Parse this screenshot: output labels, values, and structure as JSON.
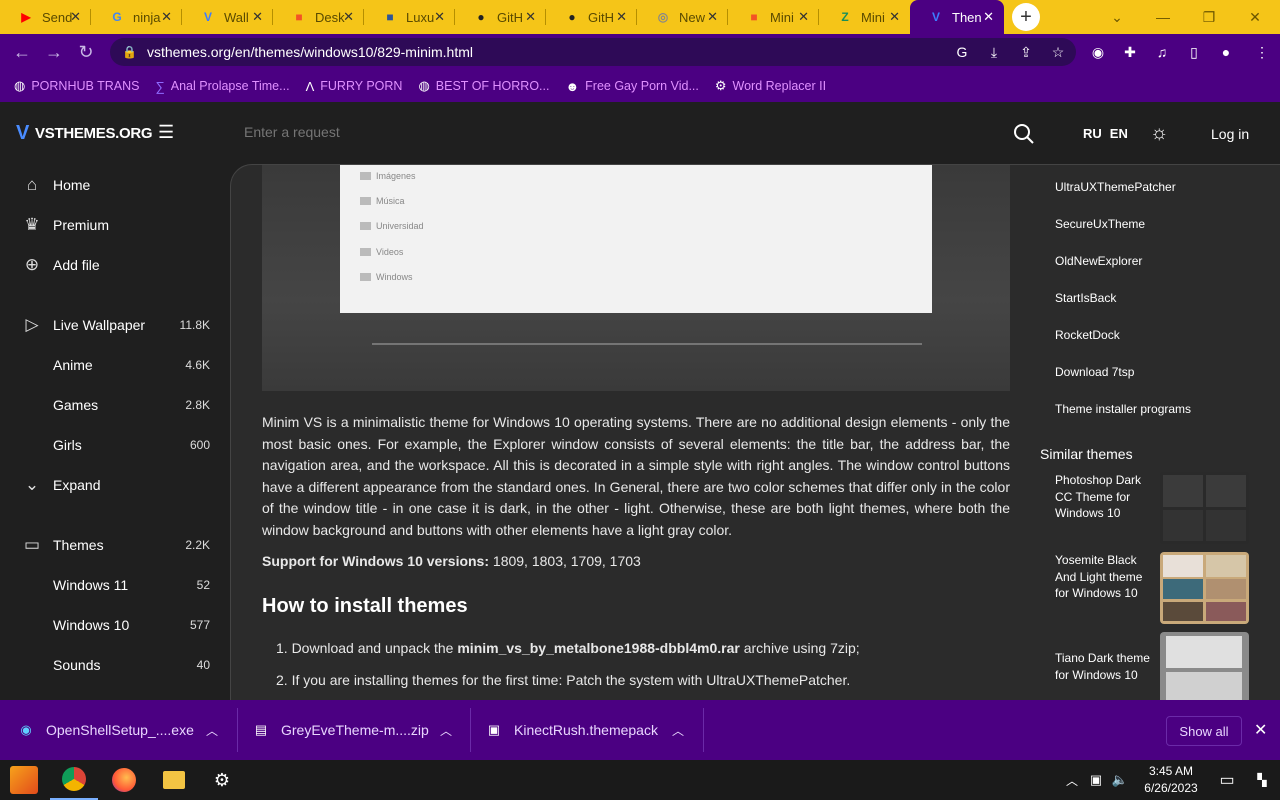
{
  "browser": {
    "tabs": [
      {
        "label": "Send",
        "icon": "youtube-icon",
        "color": "#ff0000"
      },
      {
        "label": "ninja",
        "icon": "google-icon",
        "color": "#4285f4"
      },
      {
        "label": "Wall",
        "icon": "vsthemes-icon",
        "color": "#3d7cff"
      },
      {
        "label": "Desk",
        "icon": "microsoft-icon",
        "color": "#f35325"
      },
      {
        "label": "Luxu",
        "icon": "luxury-icon",
        "color": "#2f5597"
      },
      {
        "label": "GitH",
        "icon": "github-icon",
        "color": "#222222"
      },
      {
        "label": "GitH",
        "icon": "github-icon",
        "color": "#222222"
      },
      {
        "label": "New",
        "icon": "new-tab-icon",
        "color": "#888888"
      },
      {
        "label": "Mini",
        "icon": "microsoft-icon",
        "color": "#f35325"
      },
      {
        "label": "Mini",
        "icon": "nexus-icon",
        "color": "#1a8f5a"
      },
      {
        "label": "Then",
        "icon": "vsthemes-icon",
        "color": "#3d7cff"
      }
    ],
    "url": "vsthemes.org/en/themes/windows10/829-minim.html",
    "bookmarks": [
      {
        "label": "PORNHUB TRANS",
        "icon": "globe-icon"
      },
      {
        "label": "Anal Prolapse Time...",
        "icon": "bookmark-icon"
      },
      {
        "label": "FURRY PORN",
        "icon": "furry-icon"
      },
      {
        "label": "BEST OF HORRO...",
        "icon": "globe-icon"
      },
      {
        "label": "Free Gay Porn Vid...",
        "icon": "site-icon"
      },
      {
        "label": "Word Replacer II",
        "icon": "extension-icon"
      }
    ]
  },
  "site": {
    "logo": "VSTHEMES.ORG",
    "search_placeholder": "Enter a request",
    "lang_ru": "RU",
    "lang_en": "EN",
    "login": "Log in"
  },
  "sidebar": [
    {
      "label": "Home",
      "icon": "home-icon",
      "count": ""
    },
    {
      "label": "Premium",
      "icon": "crown-icon",
      "count": ""
    },
    {
      "label": "Add file",
      "icon": "plus-circle-icon",
      "count": ""
    },
    {
      "label": "Live Wallpaper",
      "icon": "play-icon",
      "count": "11.8K"
    },
    {
      "label": "Anime",
      "icon": "",
      "count": "4.6K"
    },
    {
      "label": "Games",
      "icon": "",
      "count": "2.8K"
    },
    {
      "label": "Girls",
      "icon": "",
      "count": "600"
    },
    {
      "label": "Expand",
      "icon": "chevron-down-icon",
      "count": ""
    },
    {
      "label": "Themes",
      "icon": "monitor-icon",
      "count": "2.2K"
    },
    {
      "label": "Windows 11",
      "icon": "",
      "count": "52"
    },
    {
      "label": "Windows 10",
      "icon": "",
      "count": "577"
    },
    {
      "label": "Sounds",
      "icon": "",
      "count": "40"
    }
  ],
  "hero_folders": [
    "Imágenes",
    "Música",
    "Universidad",
    "Videos",
    "Windows"
  ],
  "article": {
    "description": "Minim VS is a minimalistic theme for Windows 10 operating systems. There are no additional design elements - only the most basic ones. For example, the Explorer window consists of several elements: the title bar, the address bar, the navigation area, and the workspace. All this is decorated in a simple style with right angles. The window control buttons have a different appearance from the standard ones. In General, there are two color schemes that differ only in the color of the window title - in one case it is dark, in the other - light. Otherwise, these are both light themes, where both the window background and buttons with other elements have a light gray color.",
    "support_label": "Support for Windows 10 versions:",
    "support_versions": "1809, 1803, 1709, 1703",
    "howto_title": "How to install themes",
    "step1_prefix": "1. Download and unpack the ",
    "step1_file": "minim_vs_by_metalbone1988-dbbl4m0.rar",
    "step1_suffix": " archive using 7zip;",
    "step2": "2. If you are installing themes for the first time: Patch the system with UltraUXThemePatcher."
  },
  "right_links": [
    "UltraUXThemePatcher",
    "SecureUxTheme",
    "OldNewExplorer",
    "StartIsBack",
    "RocketDock",
    "Download 7tsp",
    "Theme installer programs"
  ],
  "similar": {
    "title": "Similar themes",
    "items": [
      {
        "title": "Photoshop Dark CC Theme for Windows 10"
      },
      {
        "title": "Yosemite Black And Light theme for Windows 10"
      },
      {
        "title": "Tiano Dark theme for Windows 10"
      }
    ]
  },
  "downloads": {
    "items": [
      {
        "name": "OpenShellSetup_....exe",
        "icon": "installer-icon"
      },
      {
        "name": "GreyEveTheme-m....zip",
        "icon": "zip-icon"
      },
      {
        "name": "KinectRush.themepack",
        "icon": "themepack-icon"
      }
    ],
    "show_all": "Show all"
  },
  "taskbar": {
    "time": "3:45 AM",
    "date": "6/26/2023"
  },
  "colors": {
    "browser_frame": "#4b0082",
    "tabstrip": "#f5c518",
    "accent": "#3d7cff"
  }
}
